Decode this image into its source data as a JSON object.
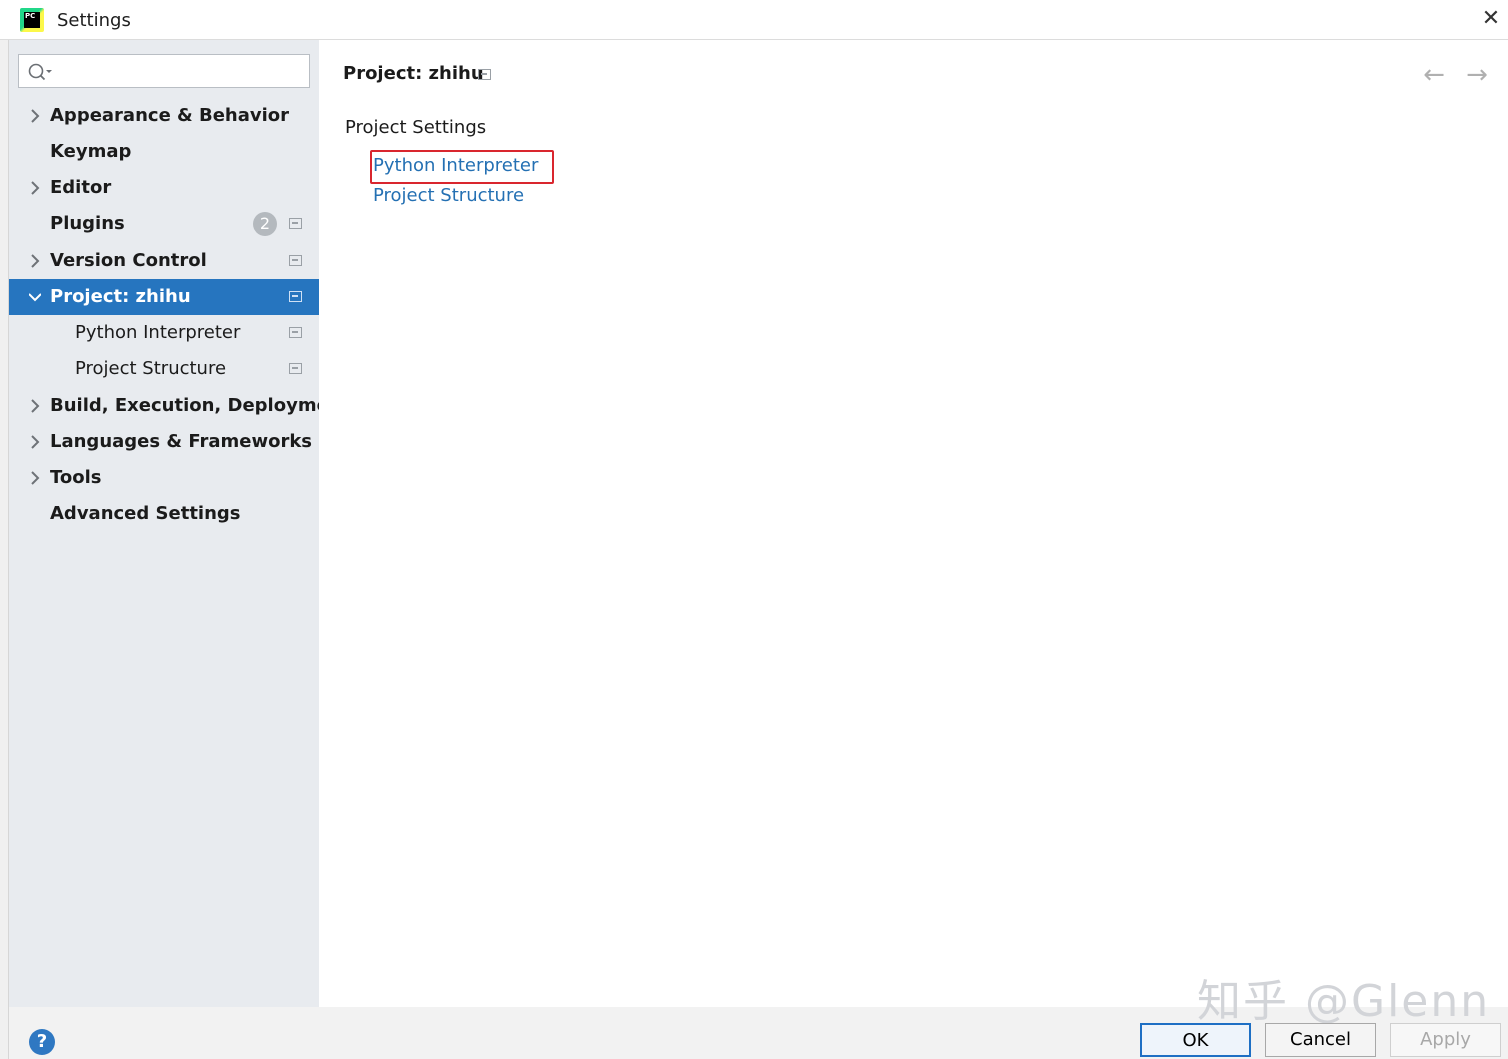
{
  "window": {
    "title": "Settings",
    "close_glyph": "✕"
  },
  "search": {
    "value": "",
    "placeholder": ""
  },
  "sidebar": {
    "items": [
      {
        "label": "Appearance & Behavior"
      },
      {
        "label": "Keymap"
      },
      {
        "label": "Editor"
      },
      {
        "label": "Plugins",
        "badge": "2"
      },
      {
        "label": "Version Control"
      },
      {
        "label": "Project: zhihu"
      },
      {
        "label": "Python Interpreter"
      },
      {
        "label": "Project Structure"
      },
      {
        "label": "Build, Execution, Deployment"
      },
      {
        "label": "Languages & Frameworks"
      },
      {
        "label": "Tools"
      },
      {
        "label": "Advanced Settings"
      }
    ],
    "selected_color": "#2675bf"
  },
  "main": {
    "title": "Project: zhihu",
    "section": "Project Settings",
    "links": [
      "Python Interpreter",
      "Project Structure"
    ],
    "highlight_color": "#d9262e",
    "back_glyph": "←",
    "forward_glyph": "→"
  },
  "footer": {
    "help": "?",
    "watermark": "知乎 @Glenn",
    "ok_label": "OK",
    "cancel_label": "Cancel",
    "apply_label": "Apply"
  }
}
